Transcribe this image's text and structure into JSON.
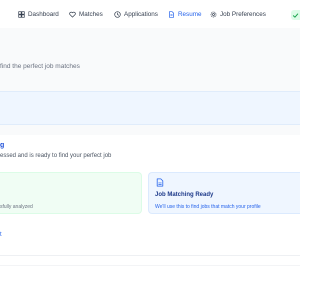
{
  "nav": {
    "items": [
      {
        "label": "Dashboard",
        "icon": "dashboard-icon",
        "active": false
      },
      {
        "label": "Matches",
        "icon": "heart-icon",
        "active": false
      },
      {
        "label": "Applications",
        "icon": "clock-icon",
        "active": false
      },
      {
        "label": "Resume",
        "icon": "document-icon",
        "active": true
      },
      {
        "label": "Job Preferences",
        "icon": "gear-icon",
        "active": false
      }
    ],
    "active_color": "#2563eb"
  },
  "main": {
    "subtitle": "find the perfect job matches",
    "status_card": {
      "title": "g",
      "description": "essed and is ready to find your perfect job",
      "analysis_tile": {
        "text": "sfully analyzed"
      },
      "matching_tile": {
        "icon": "document-icon",
        "title": "Job Matching Ready",
        "text": "We'll use this to find jobs that match your profile"
      },
      "link_fragment": "t"
    }
  },
  "colors": {
    "accent": "#2563eb",
    "success_bg": "#f0fdf4",
    "info_bg": "#eff6ff"
  }
}
